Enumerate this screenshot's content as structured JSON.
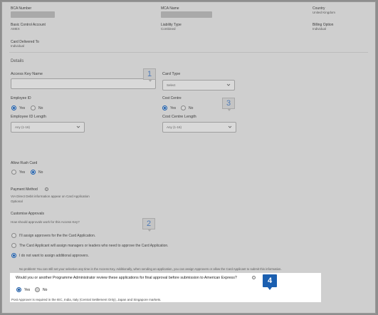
{
  "header": {
    "bca_number_label": "BCA Number",
    "mca_name_label": "MCA Name",
    "country_label": "Country",
    "country_value": "United Kingdom",
    "basic_control_account_label": "Basic Control Account",
    "basic_control_account_value": "AMEX",
    "liability_type_label": "Liability Type",
    "liability_type_value": "Combined",
    "billing_option_label": "Billing Option",
    "billing_option_value": "Individual",
    "card_delivered_to_label": "Card Delivered To",
    "card_delivered_to_value": "Individual"
  },
  "details": {
    "heading": "Details",
    "access_key_name_label": "Access Key Name",
    "access_key_name_value": "",
    "card_type_label": "Card Type",
    "card_type_value": "Select",
    "employee_id_label": "Employee ID",
    "employee_id_yes": "Yes",
    "employee_id_no": "No",
    "cost_centre_label": "Cost Centre",
    "cost_centre_yes": "Yes",
    "cost_centre_no": "No",
    "employee_id_length_label": "Employee ID Length",
    "employee_id_length_value": "Any (1-16)",
    "cost_centre_length_label": "Cost Centre Length",
    "cost_centre_length_value": "Any (1-16)",
    "allow_rush_card_label": "Allow Rush Card",
    "allow_rush_yes": "Yes",
    "allow_rush_no": "No",
    "payment_method_label": "Payment Method",
    "payment_method_desc": "VIA Direct Debit information appear on Card Application",
    "payment_method_value": "Optional"
  },
  "approvals": {
    "heading": "Customise Approvals",
    "question": "How should approvals work for this Access Key?",
    "option1": "I'll assign approvers for the the Card Application.",
    "option2": "The Card Applicant will assign managers or leaders who need to approve the Card Application.",
    "option3": "I do not want to assign additional approvers.",
    "note": "No problem! You can still set your selection any time in the Access Key. Additionally, when sending an application, you can assign Approvers or allow the Card Applicant to submit this information.",
    "final_question": "Would you or another Programme Administrator review these applications for final approval before submission to American Express?",
    "final_yes": "Yes",
    "final_no": "No",
    "footnote": "Post Approver is required in the IEC, India, Italy (Central Settlement Only), Japan and Singapore markets."
  },
  "steps": {
    "s1": "1",
    "s2": "2",
    "s3": "3",
    "s4": "4"
  },
  "colors": {
    "accent": "#1b5fb0",
    "overlay": "#cfcfcf"
  },
  "icons": {
    "chevron": "chevron-down-icon",
    "info": "info-icon"
  }
}
